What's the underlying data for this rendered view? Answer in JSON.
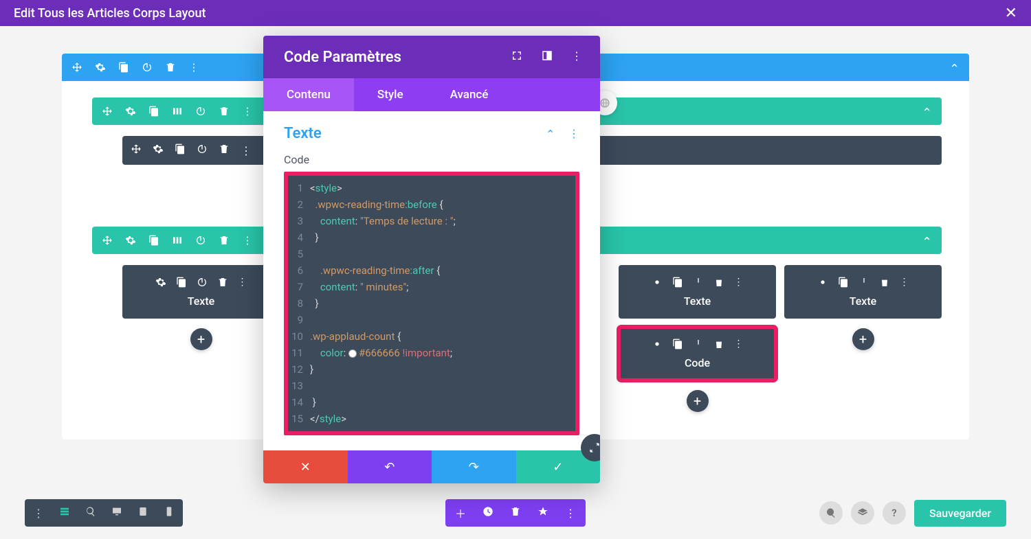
{
  "titleBar": {
    "title": "Edit Tous les Articles Corps Layout"
  },
  "modal": {
    "title": "Code Paramètres",
    "tabs": {
      "content": "Contenu",
      "design": "Style",
      "advanced": "Avancé"
    },
    "section": {
      "title": "Texte",
      "fieldLabel": "Code"
    },
    "code": {
      "lines": [
        {
          "n": "1",
          "html": "<span class='tk-br'>&lt;</span><span class='tk-tag'>style</span><span class='tk-br'>&gt;</span>"
        },
        {
          "n": "2",
          "html": "  <span class='tk-sel'>.wpwc-reading-time</span><span class='tk-psel'>:before</span> <span class='tk-br'>{</span>"
        },
        {
          "n": "3",
          "html": "    <span class='tk-prop'>content</span>: <span class='tk-str'>\"Temps de lecture : \"</span>;"
        },
        {
          "n": "4",
          "html": "  <span class='tk-br'>}</span>"
        },
        {
          "n": "5",
          "html": ""
        },
        {
          "n": "6",
          "html": "    <span class='tk-sel'>.wpwc-reading-time</span><span class='tk-psel'>:after</span> <span class='tk-br'>{</span>"
        },
        {
          "n": "7",
          "html": "    <span class='tk-prop'>content</span>: <span class='tk-str'>\" minutes\"</span>;"
        },
        {
          "n": "8",
          "html": "  <span class='tk-br'>}</span>"
        },
        {
          "n": "9",
          "html": ""
        },
        {
          "n": "10",
          "html": "<span class='tk-sel'>.wp-applaud-count</span> <span class='tk-br'>{</span>"
        },
        {
          "n": "11",
          "html": "    <span class='tk-prop'>color</span>: <span class='color-swatch'></span><span class='tk-str'>#666666</span> <span class='tk-imp'>!important</span>;"
        },
        {
          "n": "12",
          "html": "<span class='tk-br'>}</span>"
        },
        {
          "n": "13",
          "html": ""
        },
        {
          "n": "14",
          "html": " <span class='tk-br'>}</span>"
        },
        {
          "n": "15",
          "html": "<span class='tk-br'>&lt;/</span><span class='tk-tag'>style</span><span class='tk-br'>&gt;</span>"
        }
      ]
    }
  },
  "modules": {
    "texte": "Texte",
    "code": "Code"
  },
  "bottomBar": {
    "save": "Sauvegarder"
  }
}
